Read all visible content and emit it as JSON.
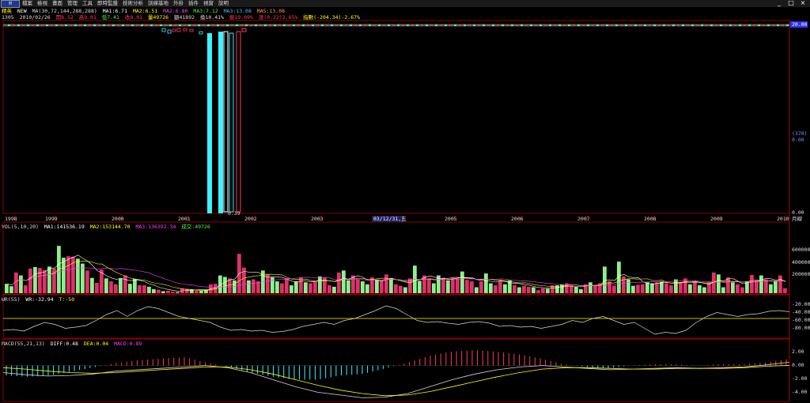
{
  "app": {
    "logo": "H",
    "menu": [
      "檔案",
      "檢視",
      "畫面",
      "管理",
      "工具",
      "即時監盤",
      "技術分析",
      "訓練基地",
      "外掛",
      "插件",
      "視窗",
      "說明"
    ],
    "window_buttons": [
      "_",
      "□",
      "×"
    ]
  },
  "price_panel": {
    "line1": {
      "name": "精英",
      "new": "NEW",
      "ma_params": "MA(30,72,144,288,288)",
      "ma1": "MA1:6.71",
      "ma2": "MA2:6.51",
      "ma2b": "MA2:6.80",
      "ma3": "MA3:7.12",
      "ma4": "MA3:13.08",
      "ma5": "MA5:13.08"
    },
    "line2": {
      "code": "1305",
      "date": "2010/02/26",
      "open": "開8.52",
      "high": "高9.01",
      "low": "低7.41",
      "close": "收8.01",
      "vol": "量49726",
      "amt": "額41892",
      "turnover": "換10.41%",
      "amp": "振19.09%",
      "change": "漲(0.22)2.65%",
      "index": "指數(-204.34)-2.67%"
    },
    "right_labels": [
      "20.00",
      "(370)",
      "0.00",
      "0.00"
    ],
    "bottom_value": "0.39"
  },
  "time_axis": {
    "labels": [
      "1998",
      "1999",
      "2000",
      "2001",
      "2002",
      "2003",
      "2005",
      "2006",
      "2007",
      "2008",
      "2009",
      "2010"
    ],
    "cursor_date": "03/12/31,五",
    "unit": "月線"
  },
  "volume_panel": {
    "title": "VOL(5,10,20)",
    "ma1": "MA1:141536.19",
    "ma2": "MA2:153144.70",
    "ma3": "MA3:136392.34",
    "current": "成交:49726",
    "ticks": [
      "600000",
      "400000",
      "200000"
    ]
  },
  "wr_panel": {
    "title": "WR(55)",
    "wr": "WR:-32.94",
    "ref": "T:-50",
    "ticks": [
      "-20.00",
      "-40.00",
      "-60.00",
      "-80.00"
    ]
  },
  "macd_panel": {
    "title": "MACD(55,21,13)",
    "diff": "DIFF:0.48",
    "dea": "DEA:0.04",
    "macd": "MACD:0.89",
    "ticks": [
      "2.00",
      "0.00",
      "-2.00",
      "-4.00"
    ]
  },
  "colors": {
    "up": "#ff3b5c",
    "down": "#3cf2ff",
    "vol_up": "#e0306a",
    "vol_down": "#8cf08c",
    "frame": "#b00000",
    "yellow": "#ffff00",
    "white": "#d8d8d8",
    "magenta": "#ff40ff"
  },
  "chart_data": [
    {
      "type": "candlestick",
      "title": "精英",
      "series": [
        {
          "name": "MA1",
          "values": [
            6.71
          ]
        },
        {
          "name": "MA2",
          "values": [
            6.51
          ]
        },
        {
          "name": "MA3",
          "values": [
            7.12
          ]
        }
      ],
      "note_visible": "price collapse around 2001-2002 dips to 0.39"
    },
    {
      "type": "bar",
      "title": "VOL(5,10,20)",
      "ylim": [
        0,
        650000
      ],
      "values": [
        95000,
        70000,
        210000,
        180000,
        80000,
        250000,
        265000,
        255000,
        235000,
        270000,
        250000,
        480000,
        360000,
        375000,
        370000,
        350000,
        300000,
        230000,
        155000,
        105000,
        240000,
        150000,
        120000,
        90000,
        150000,
        180000,
        95000,
        145000,
        80000,
        80000,
        65000,
        40000,
        35000,
        20000,
        25000,
        15000,
        10000,
        50000,
        45000,
        40000,
        25000,
        25000,
        35000,
        90000,
        95000,
        180000,
        165000,
        150000,
        130000,
        400000,
        260000,
        130000,
        140000,
        120000,
        230000,
        190000,
        160000,
        120000,
        100000,
        150000,
        80000,
        120000,
        160000,
        110000,
        100000,
        120000,
        170000,
        160000,
        80000,
        65000,
        210000,
        230000,
        130000,
        180000,
        140000,
        120000,
        90000,
        160000,
        135000,
        125000,
        190000,
        150000,
        90000,
        75000,
        60000,
        150000,
        280000,
        125000,
        180000,
        140000,
        100000,
        180000,
        155000,
        130000,
        155000,
        150000,
        220000,
        135000,
        120000,
        60000,
        120000,
        200000,
        100000,
        80000,
        125000,
        90000,
        130000,
        80000,
        60000,
        75000,
        65000,
        60000,
        30000,
        50000,
        45000,
        80000,
        80000,
        90000,
        100000,
        80000,
        65000,
        40000,
        90000,
        110000,
        75000,
        100000,
        270000,
        120000,
        75000,
        320000,
        170000,
        140000,
        75000,
        85000,
        90000,
        110000,
        100000,
        110000,
        120000,
        100000,
        80000,
        140000,
        110000,
        150000,
        90000,
        115000,
        80000,
        60000,
        110000,
        210000,
        190000,
        60000,
        160000,
        110000,
        90000,
        60000,
        120000,
        185000,
        130000,
        180000,
        140000,
        90000,
        120000,
        180000,
        50000
      ]
    },
    {
      "type": "line",
      "title": "WR(55)",
      "ylim": [
        -100,
        0
      ],
      "series": [
        {
          "name": "WR",
          "values": [
            -80,
            -78,
            -82,
            -70,
            -60,
            -65,
            -75,
            -72,
            -68,
            -55,
            -40,
            -30,
            -45,
            -30,
            -20,
            -25,
            -35,
            -45,
            -50,
            -55,
            -60,
            -72,
            -80,
            -78,
            -82,
            -80,
            -85,
            -83,
            -78,
            -70,
            -65,
            -60,
            -65,
            -55,
            -50,
            -40,
            -30,
            -18,
            -25,
            -40,
            -55,
            -60,
            -58,
            -62,
            -65,
            -60,
            -58,
            -62,
            -70,
            -68,
            -72,
            -70,
            -75,
            -70,
            -65,
            -55,
            -60,
            -50,
            -45,
            -55,
            -65,
            -60,
            -75,
            -90,
            -85,
            -88,
            -80,
            -60,
            -45,
            -35,
            -40,
            -45,
            -40,
            -38,
            -32,
            -30,
            -33
          ]
        }
      ]
    },
    {
      "type": "bar",
      "title": "MACD(55,21,13)",
      "ylim": [
        -5,
        3
      ],
      "series": [
        {
          "name": "DIFF",
          "values": [
            -1.0,
            -1.3,
            -1.5,
            -1.4,
            -1.2,
            -0.8,
            -0.6,
            -0.4,
            -0.2,
            0.0,
            -0.3,
            -1.0,
            -2.0,
            -3.0,
            -3.8,
            -4.2,
            -4.6,
            -4.5,
            -4.0,
            -3.0,
            -2.0,
            -1.2,
            -0.6,
            -0.2,
            0.0,
            -0.2,
            -0.4,
            -0.6,
            -0.5,
            -0.4,
            -0.3,
            -0.4,
            -0.3,
            -0.2,
            0.1,
            0.48
          ]
        },
        {
          "name": "DEA",
          "values": [
            -0.3,
            -0.5,
            -0.8,
            -1.0,
            -1.1,
            -1.0,
            -0.8,
            -0.6,
            -0.4,
            -0.2,
            -0.2,
            -0.6,
            -1.2,
            -2.0,
            -2.8,
            -3.5,
            -4.0,
            -4.3,
            -4.2,
            -3.7,
            -3.0,
            -2.3,
            -1.6,
            -1.0,
            -0.5,
            -0.3,
            -0.3,
            -0.4,
            -0.5,
            -0.5,
            -0.4,
            -0.4,
            -0.4,
            -0.3,
            -0.1,
            0.04
          ]
        },
        {
          "name": "MACD",
          "values": [
            -1.4,
            -1.6,
            -1.4,
            -0.8,
            -0.2,
            0.4,
            0.8,
            1.0,
            1.2,
            0.4,
            -0.2,
            -1.0,
            -1.6,
            -2.0,
            -2.0,
            -1.4,
            -1.2,
            -0.4,
            0.4,
            1.4,
            2.0,
            2.2,
            2.0,
            1.6,
            1.0,
            0.2,
            -0.2,
            -0.4,
            0.0,
            0.2,
            0.2,
            0.0,
            0.2,
            0.2,
            0.4,
            0.89
          ]
        }
      ]
    }
  ]
}
